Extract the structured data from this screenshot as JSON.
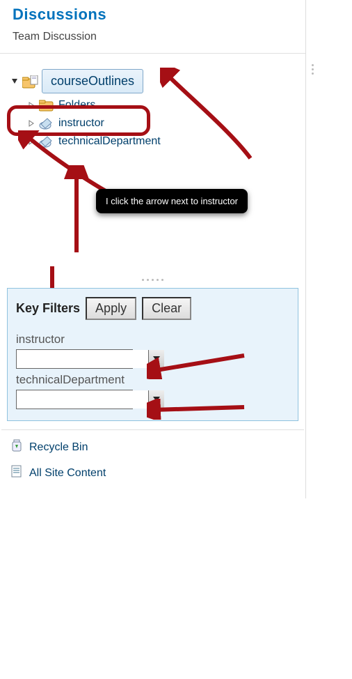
{
  "discussions": {
    "title": "Discussions",
    "team": "Team Discussion"
  },
  "tree": {
    "root": {
      "label": "courseOutlines"
    },
    "children": [
      {
        "label": "Folders",
        "icon": "folder"
      },
      {
        "label": "instructor",
        "icon": "tag"
      },
      {
        "label": "technicalDepartment",
        "icon": "tag"
      }
    ]
  },
  "annotation": {
    "callout": "I click the arrow next to instructor"
  },
  "keyfilters": {
    "title": "Key Filters",
    "apply": "Apply",
    "clear": "Clear",
    "fields": [
      {
        "label": "instructor",
        "value": ""
      },
      {
        "label": "technicalDepartment",
        "value": ""
      }
    ]
  },
  "footer": {
    "recycle": "Recycle Bin",
    "allcontent": "All Site Content"
  }
}
